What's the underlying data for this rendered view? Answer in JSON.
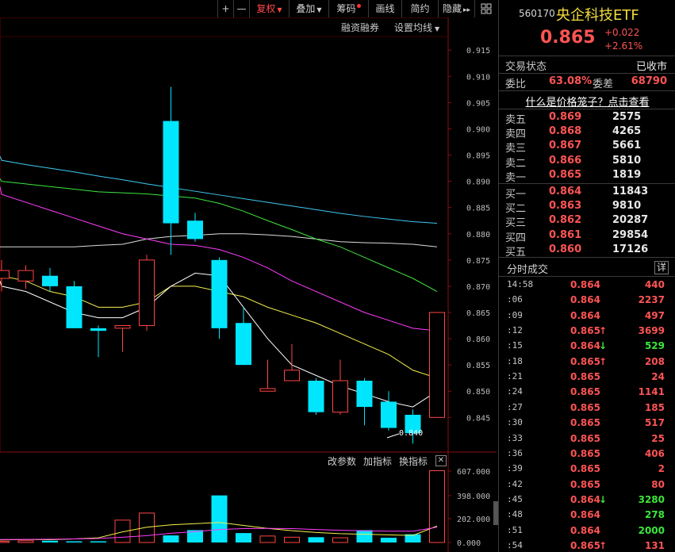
{
  "toolbar": {
    "zoom_in": "+",
    "zoom_out": "—",
    "fuquan": "复权",
    "diejia": "叠加",
    "chouma": "筹码",
    "huaxian": "画线",
    "jianyue": "简约",
    "yincang": "隐藏",
    "arrow_right": "▸▸",
    "grid_icon": "grid-icon"
  },
  "chart_header": {
    "margin_trading": "融资融券",
    "ma_settings": "设置均线"
  },
  "indicator_bar": {
    "change_params": "改参数",
    "add_indicator": "加指标",
    "switch_indicator": "换指标",
    "close": "✕"
  },
  "colors": {
    "up": "#ff4545",
    "down": "#00e6ff",
    "ma5": "#ffffff",
    "ma10": "#f4f04a",
    "ma20": "#ff3cff",
    "ma30": "#3ce63c",
    "ma60": "#dcdcdc",
    "ma120": "#3fc9f2"
  },
  "chart_data": [
    {
      "type": "candlestick",
      "y_axis_labels": [
        "0.915",
        "0.910",
        "0.905",
        "0.900",
        "0.895",
        "0.890",
        "0.885",
        "0.880",
        "0.875",
        "0.870",
        "0.865",
        "0.860",
        "0.855",
        "0.850",
        "0.845"
      ],
      "ylim": [
        0.839,
        0.917
      ],
      "low_annotation": "0.840",
      "candles": [
        {
          "o": 0.8715,
          "c": 0.873,
          "h": 0.875,
          "l": 0.869
        },
        {
          "o": 0.871,
          "c": 0.873,
          "h": 0.874,
          "l": 0.8695
        },
        {
          "o": 0.872,
          "c": 0.87,
          "h": 0.8735,
          "l": 0.869
        },
        {
          "o": 0.87,
          "c": 0.862,
          "h": 0.871,
          "l": 0.862
        },
        {
          "o": 0.862,
          "c": 0.8615,
          "h": 0.8625,
          "l": 0.8565
        },
        {
          "o": 0.862,
          "c": 0.8625,
          "h": 0.8625,
          "l": 0.8575
        },
        {
          "o": 0.8625,
          "c": 0.875,
          "h": 0.876,
          "l": 0.8615
        },
        {
          "o": 0.9015,
          "c": 0.882,
          "h": 0.908,
          "l": 0.876
        },
        {
          "o": 0.8825,
          "c": 0.879,
          "h": 0.884,
          "l": 0.8785
        },
        {
          "o": 0.875,
          "c": 0.862,
          "h": 0.8755,
          "l": 0.86
        },
        {
          "o": 0.863,
          "c": 0.855,
          "h": 0.866,
          "l": 0.855
        },
        {
          "o": 0.85,
          "c": 0.8505,
          "h": 0.856,
          "l": 0.85
        },
        {
          "o": 0.852,
          "c": 0.854,
          "h": 0.859,
          "l": 0.852
        },
        {
          "o": 0.852,
          "c": 0.846,
          "h": 0.8525,
          "l": 0.8455
        },
        {
          "o": 0.846,
          "c": 0.852,
          "h": 0.856,
          "l": 0.8455
        },
        {
          "o": 0.852,
          "c": 0.847,
          "h": 0.8525,
          "l": 0.8435
        },
        {
          "o": 0.848,
          "c": 0.843,
          "h": 0.85,
          "l": 0.8425
        },
        {
          "o": 0.8455,
          "c": 0.842,
          "h": 0.8465,
          "l": 0.84
        },
        {
          "o": 0.845,
          "c": 0.865,
          "h": 0.865,
          "l": 0.845
        }
      ],
      "ma5": [
        0.87,
        0.869,
        0.867,
        0.865,
        0.864,
        0.864,
        0.866,
        0.87,
        0.8725,
        0.872,
        0.866,
        0.86,
        0.855,
        0.853,
        0.851,
        0.8495,
        0.848,
        0.847,
        0.85
      ],
      "ma10": [
        0.872,
        0.871,
        0.869,
        0.868,
        0.866,
        0.866,
        0.867,
        0.87,
        0.87,
        0.869,
        0.868,
        0.866,
        0.8645,
        0.863,
        0.861,
        0.859,
        0.857,
        0.854,
        0.8525
      ],
      "ma20": [
        0.8875,
        0.886,
        0.8845,
        0.883,
        0.8815,
        0.88,
        0.879,
        0.878,
        0.8778,
        0.877,
        0.8755,
        0.8735,
        0.871,
        0.869,
        0.867,
        0.865,
        0.8635,
        0.862,
        0.8615
      ],
      "ma30": [
        0.89,
        0.8895,
        0.889,
        0.8885,
        0.888,
        0.8878,
        0.8876,
        0.8872,
        0.8868,
        0.8858,
        0.8843,
        0.8825,
        0.8808,
        0.879,
        0.8775,
        0.8755,
        0.8735,
        0.8715,
        0.869
      ],
      "ma60": [
        0.8775,
        0.8775,
        0.8775,
        0.8775,
        0.8778,
        0.878,
        0.879,
        0.8795,
        0.8797,
        0.88,
        0.88,
        0.8798,
        0.8795,
        0.879,
        0.8785,
        0.8783,
        0.8782,
        0.878,
        0.8775
      ],
      "ma120": [
        0.894,
        0.8932,
        0.8925,
        0.8918,
        0.891,
        0.8903,
        0.8895,
        0.8888,
        0.8881,
        0.8874,
        0.8867,
        0.886,
        0.8853,
        0.8846,
        0.8839,
        0.8833,
        0.8828,
        0.8823,
        0.882
      ]
    },
    {
      "type": "bar",
      "y_axis_labels": [
        "607.000",
        "398.000",
        "202.000",
        "0.000"
      ],
      "ylim": [
        0,
        620
      ],
      "values": [
        15,
        10,
        15,
        15,
        10,
        10,
        190,
        250,
        60,
        105,
        400,
        80,
        55,
        45,
        45,
        40,
        105,
        40,
        70,
        610
      ],
      "line1": [
        20,
        22,
        25,
        24,
        30,
        40,
        90,
        130,
        150,
        160,
        170,
        145,
        120,
        100,
        85,
        75,
        70,
        65,
        60,
        140
      ],
      "line2": [
        25,
        25,
        26,
        28,
        30,
        34,
        45,
        58,
        78,
        92,
        110,
        118,
        120,
        118,
        110,
        104,
        99,
        96,
        96,
        130
      ]
    }
  ],
  "quote": {
    "code": "560170",
    "name": "央企科技ETF",
    "price": "0.865",
    "change": "+0.022",
    "change_pct": "+2.61%",
    "trade_status_label": "交易状态",
    "trade_status_value": "已收市",
    "weibi_label": "委比",
    "weibi_value": "63.08%",
    "weicha_label": "委差",
    "weicha_value": "68790",
    "cage_link": "什么是价格笼子？点击查看"
  },
  "order_book": {
    "asks": [
      {
        "label": "卖五",
        "price": "0.869",
        "vol": "2575"
      },
      {
        "label": "卖四",
        "price": "0.868",
        "vol": "4265"
      },
      {
        "label": "卖三",
        "price": "0.867",
        "vol": "5661"
      },
      {
        "label": "卖二",
        "price": "0.866",
        "vol": "5810"
      },
      {
        "label": "卖一",
        "price": "0.865",
        "vol": "1819"
      }
    ],
    "bids": [
      {
        "label": "买一",
        "price": "0.864",
        "vol": "11843"
      },
      {
        "label": "买二",
        "price": "0.863",
        "vol": "9810"
      },
      {
        "label": "买三",
        "price": "0.862",
        "vol": "20287"
      },
      {
        "label": "买四",
        "price": "0.861",
        "vol": "29854"
      },
      {
        "label": "买五",
        "price": "0.860",
        "vol": "17126"
      }
    ]
  },
  "trades": {
    "title": "分时成交",
    "detail": "详",
    "rows": [
      {
        "time": "14:58",
        "price": "0.864",
        "arrow": "",
        "vol": "440",
        "dir": "red"
      },
      {
        "time": ":06",
        "price": "0.864",
        "arrow": "",
        "vol": "2237",
        "dir": "red"
      },
      {
        "time": ":09",
        "price": "0.864",
        "arrow": "",
        "vol": "497",
        "dir": "red"
      },
      {
        "time": ":12",
        "price": "0.865",
        "arrow": "↑",
        "vol": "3699",
        "dir": "red"
      },
      {
        "time": ":15",
        "price": "0.864",
        "arrow": "↓",
        "vol": "529",
        "dir": "green"
      },
      {
        "time": ":18",
        "price": "0.865",
        "arrow": "↑",
        "vol": "208",
        "dir": "red"
      },
      {
        "time": ":21",
        "price": "0.865",
        "arrow": "",
        "vol": "24",
        "dir": "red"
      },
      {
        "time": ":24",
        "price": "0.865",
        "arrow": "",
        "vol": "1141",
        "dir": "red"
      },
      {
        "time": ":27",
        "price": "0.865",
        "arrow": "",
        "vol": "185",
        "dir": "red"
      },
      {
        "time": ":30",
        "price": "0.865",
        "arrow": "",
        "vol": "517",
        "dir": "red"
      },
      {
        "time": ":33",
        "price": "0.865",
        "arrow": "",
        "vol": "25",
        "dir": "red"
      },
      {
        "time": ":36",
        "price": "0.865",
        "arrow": "",
        "vol": "406",
        "dir": "red"
      },
      {
        "time": ":39",
        "price": "0.865",
        "arrow": "",
        "vol": "2",
        "dir": "red"
      },
      {
        "time": ":42",
        "price": "0.865",
        "arrow": "",
        "vol": "80",
        "dir": "red"
      },
      {
        "time": ":45",
        "price": "0.864",
        "arrow": "↓",
        "vol": "3280",
        "dir": "green"
      },
      {
        "time": ":48",
        "price": "0.864",
        "arrow": "",
        "vol": "278",
        "dir": "green"
      },
      {
        "time": ":51",
        "price": "0.864",
        "arrow": "",
        "vol": "2000",
        "dir": "green"
      },
      {
        "time": ":54",
        "price": "0.865",
        "arrow": "↑",
        "vol": "131",
        "dir": "red"
      }
    ]
  }
}
